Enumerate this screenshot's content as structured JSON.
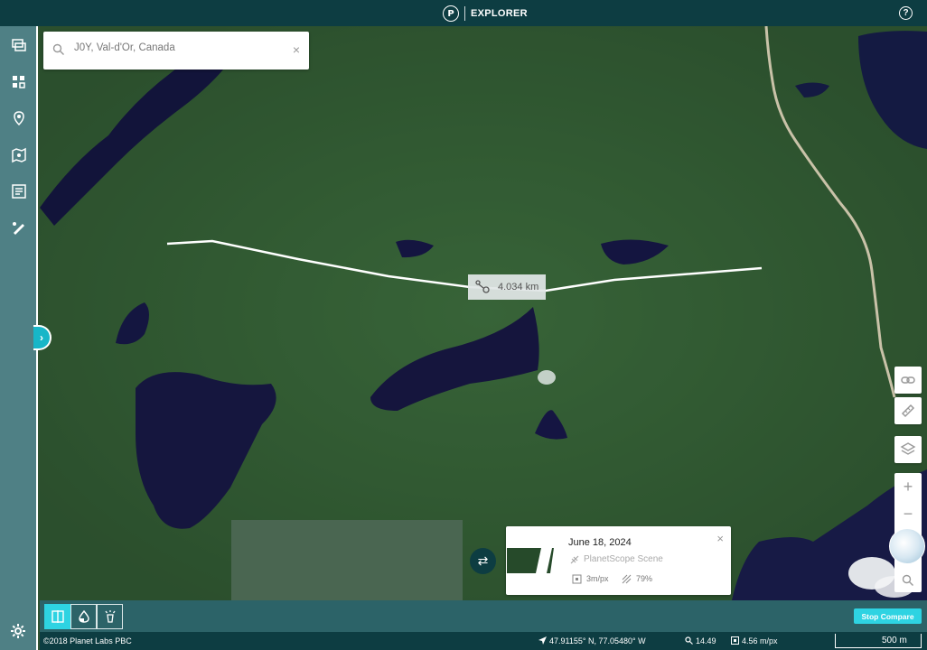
{
  "header": {
    "logo_letter": "P",
    "title": "EXPLORER",
    "help_symbol": "?"
  },
  "search": {
    "value": "J0Y, Val-d'Or, Canada",
    "placeholder": "Search"
  },
  "sidebar": {
    "items": [
      "layers-icon",
      "mosaic-grid-icon",
      "pin-icon",
      "map-icon",
      "article-icon",
      "draw-icon"
    ]
  },
  "measurement": {
    "distance": "4.034 km"
  },
  "scene_card": {
    "date": "June 18, 2024",
    "scene_type": "PlanetScope Scene",
    "resolution": "3m/px",
    "cloud_cover": "79%"
  },
  "compare": {
    "stop_label": "Stop Compare"
  },
  "zoom_controls": {
    "in": "+",
    "out": "−"
  },
  "footer": {
    "copyright": "©2018 Planet Labs PBC",
    "coordinates": "47.91155° N, 77.05480° W",
    "zoom": "14.49",
    "gsd": "4.56 m/px",
    "scale": "500 m"
  },
  "colors": {
    "header": "#0d3d42",
    "sidebar": "#4f8085",
    "accent": "#2ed3e2",
    "toolbar": "#2c6368"
  }
}
